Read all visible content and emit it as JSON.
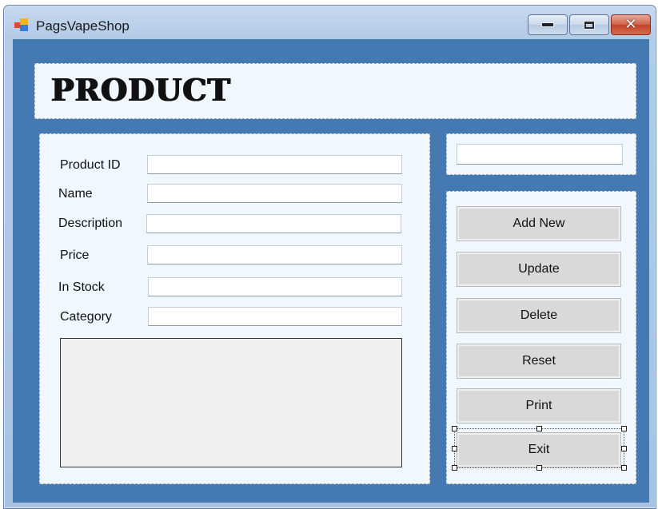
{
  "window": {
    "title": "PagsVapeShop",
    "caption_buttons": [
      "minimize-icon",
      "maximize-icon",
      "close-icon"
    ],
    "close_glyph": "✕"
  },
  "header": {
    "title": "PRODUCT"
  },
  "form": {
    "fields": [
      {
        "label": "Product ID",
        "value": ""
      },
      {
        "label": "Name",
        "value": ""
      },
      {
        "label": "Description",
        "value": ""
      },
      {
        "label": "Price",
        "value": ""
      },
      {
        "label": "In Stock",
        "value": ""
      },
      {
        "label": "Category",
        "value": ""
      }
    ],
    "listbox_items": []
  },
  "search": {
    "value": ""
  },
  "actions": {
    "add_new": "Add New",
    "update": "Update",
    "delete": "Delete",
    "reset": "Reset",
    "print": "Print",
    "exit": "Exit"
  },
  "colors": {
    "client_background": "#4479b1",
    "panel_background": "#f0f7ff",
    "button_face": "#d9d9d9",
    "close_button": "#c2432a"
  }
}
